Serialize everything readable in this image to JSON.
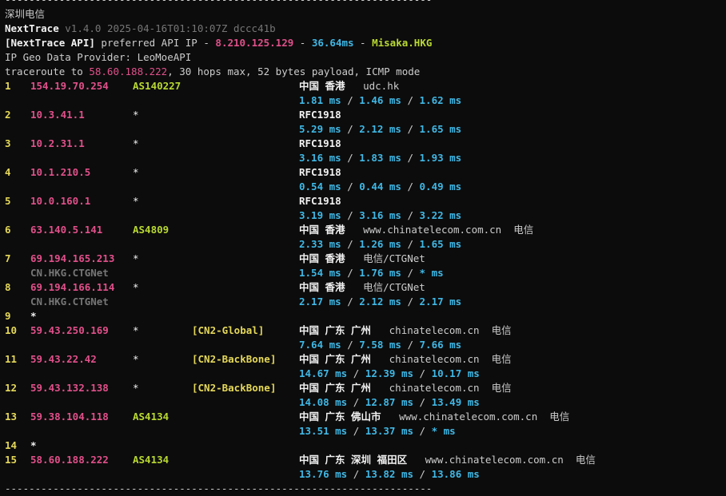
{
  "colors": {
    "background": "#0c0c0c",
    "text": "#cccccc",
    "white": "#f2f2f2",
    "ip_pink": "#e0508a",
    "latency_cyan": "#3fb8e6",
    "asn_green": "#b8d832",
    "hop_yellow": "#e5d85a",
    "gray": "#8a8a8a"
  },
  "rule_top": "-----------------------------------------------------------------------",
  "rule_bottom": "-----------------------------------------------------------------------",
  "location_title": "深圳电信",
  "header": {
    "app_name": "NextTrace",
    "version_info": "v1.4.0 2025-04-16T01:10:07Z dccc41b",
    "api_tag": "[NextTrace API]",
    "api_text": "preferred API IP - ",
    "api_ip": "8.210.125.129",
    "api_sep1": " - ",
    "api_latency": "36.64ms",
    "api_sep2": " - ",
    "api_node": "Misaka.HKG",
    "geo_provider": "IP Geo Data Provider: LeoMoeAPI",
    "traceroute_prefix": "traceroute to ",
    "traceroute_target": "58.60.188.222",
    "traceroute_suffix": ", 30 hops max, 52 bytes payload, ICMP mode"
  },
  "hops": [
    {
      "num": "1",
      "ip": "154.19.70.254",
      "asn": "AS140227",
      "tag": "",
      "location": "中国 香港",
      "host": "udc.hk",
      "isp": "",
      "latency": [
        "1.81 ms",
        "1.46 ms",
        "1.62 ms"
      ],
      "rdns": ""
    },
    {
      "num": "2",
      "ip": "10.3.41.1",
      "asn": "*",
      "tag": "",
      "location": "RFC1918",
      "host": "",
      "isp": "",
      "latency": [
        "5.29 ms",
        "2.12 ms",
        "1.65 ms"
      ],
      "rdns": ""
    },
    {
      "num": "3",
      "ip": "10.2.31.1",
      "asn": "*",
      "tag": "",
      "location": "RFC1918",
      "host": "",
      "isp": "",
      "latency": [
        "3.16 ms",
        "1.83 ms",
        "1.93 ms"
      ],
      "rdns": ""
    },
    {
      "num": "4",
      "ip": "10.1.210.5",
      "asn": "*",
      "tag": "",
      "location": "RFC1918",
      "host": "",
      "isp": "",
      "latency": [
        "0.54 ms",
        "0.44 ms",
        "0.49 ms"
      ],
      "rdns": ""
    },
    {
      "num": "5",
      "ip": "10.0.160.1",
      "asn": "*",
      "tag": "",
      "location": "RFC1918",
      "host": "",
      "isp": "",
      "latency": [
        "3.19 ms",
        "3.16 ms",
        "3.22 ms"
      ],
      "rdns": ""
    },
    {
      "num": "6",
      "ip": "63.140.5.141",
      "asn": "AS4809",
      "tag": "",
      "location": "中国 香港",
      "host": "www.chinatelecom.com.cn",
      "isp": "电信",
      "latency": [
        "2.33 ms",
        "1.26 ms",
        "1.65 ms"
      ],
      "rdns": ""
    },
    {
      "num": "7",
      "ip": "69.194.165.213",
      "asn": "*",
      "tag": "",
      "location": "中国 香港",
      "host": "电信/CTGNet",
      "isp": "",
      "latency": [
        "1.54 ms",
        "1.76 ms",
        "* ms"
      ],
      "rdns": "CN.HKG.CTGNet"
    },
    {
      "num": "8",
      "ip": "69.194.166.114",
      "asn": "*",
      "tag": "",
      "location": "中国 香港",
      "host": "电信/CTGNet",
      "isp": "",
      "latency": [
        "2.17 ms",
        "2.12 ms",
        "2.17 ms"
      ],
      "rdns": "CN.HKG.CTGNet"
    },
    {
      "num": "9",
      "ip": "*",
      "asn": "",
      "tag": "",
      "location": "",
      "host": "",
      "isp": "",
      "latency": [],
      "rdns": ""
    },
    {
      "num": "10",
      "ip": "59.43.250.169",
      "asn": "*",
      "tag": "[CN2-Global]",
      "location": "中国 广东 广州",
      "host": "chinatelecom.cn",
      "isp": "电信",
      "latency": [
        "7.64 ms",
        "7.58 ms",
        "7.66 ms"
      ],
      "rdns": ""
    },
    {
      "num": "11",
      "ip": "59.43.22.42",
      "asn": "*",
      "tag": "[CN2-BackBone]",
      "location": "中国 广东 广州",
      "host": "chinatelecom.cn",
      "isp": "电信",
      "latency": [
        "14.67 ms",
        "12.39 ms",
        "10.17 ms"
      ],
      "rdns": ""
    },
    {
      "num": "12",
      "ip": "59.43.132.138",
      "asn": "*",
      "tag": "[CN2-BackBone]",
      "location": "中国 广东 广州",
      "host": "chinatelecom.cn",
      "isp": "电信",
      "latency": [
        "14.08 ms",
        "12.87 ms",
        "13.49 ms"
      ],
      "rdns": ""
    },
    {
      "num": "13",
      "ip": "59.38.104.118",
      "asn": "AS4134",
      "tag": "",
      "location": "中国 广东 佛山市",
      "host": "www.chinatelecom.com.cn",
      "isp": "电信",
      "latency": [
        "13.51 ms",
        "13.37 ms",
        "* ms"
      ],
      "rdns": ""
    },
    {
      "num": "14",
      "ip": "*",
      "asn": "",
      "tag": "",
      "location": "",
      "host": "",
      "isp": "",
      "latency": [],
      "rdns": ""
    },
    {
      "num": "15",
      "ip": "58.60.188.222",
      "asn": "AS4134",
      "tag": "",
      "location": "中国 广东 深圳 福田区",
      "host": "www.chinatelecom.com.cn",
      "isp": "电信",
      "latency": [
        "13.76 ms",
        "13.82 ms",
        "13.86 ms"
      ],
      "rdns": ""
    }
  ]
}
